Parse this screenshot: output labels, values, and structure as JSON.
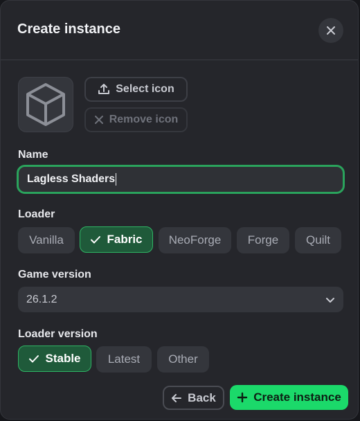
{
  "dialog": {
    "title": "Create instance",
    "close_icon": "close-icon"
  },
  "icon_section": {
    "placeholder_icon": "cube-icon",
    "select_icon_label": "Select icon",
    "remove_icon_label": "Remove icon"
  },
  "name": {
    "label": "Name",
    "value": "Lagless Shaders"
  },
  "loader": {
    "label": "Loader",
    "options": [
      "Vanilla",
      "Fabric",
      "NeoForge",
      "Forge",
      "Quilt"
    ],
    "selected": "Fabric"
  },
  "game_version": {
    "label": "Game version",
    "value": "26.1.2"
  },
  "loader_version": {
    "label": "Loader version",
    "options": [
      "Stable",
      "Latest",
      "Other"
    ],
    "selected": "Stable"
  },
  "footer": {
    "back_label": "Back",
    "create_label": "Create instance"
  },
  "colors": {
    "accent": "#1bd96a",
    "selected_bg": "#1f5a3a",
    "panel": "#25262b"
  }
}
